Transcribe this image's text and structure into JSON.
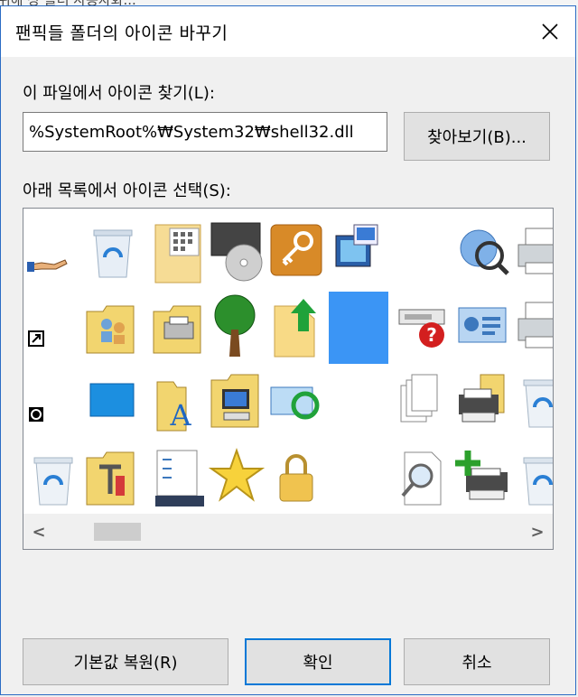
{
  "background": {
    "partial_text": "위해 상 폴더 사용자화..."
  },
  "dialog": {
    "title": "팬픽들 폴더의 아이콘 바꾸기",
    "close_glyph": "✕",
    "find_label": "이 파일에서 아이콘 찾기(L):",
    "path_value": "%SystemRoot%₩System32₩shell32.dll",
    "browse_label": "찾아보기(B)...",
    "select_label": "아래 목록에서 아이콘 선택(S):",
    "restore_label": "기본값 복원(R)",
    "ok_label": "확인",
    "cancel_label": "취소"
  },
  "icons": [
    [
      "hand-share-icon",
      "recycle-bin-full-icon",
      "calculator-grid-icon",
      "cd-drive-icon",
      "key-icon",
      "network-screen-icon",
      "empty-icon",
      "search-globe-icon",
      "printer-icon"
    ],
    [
      "shortcut-arrow-icon",
      "folder-people-icon",
      "folder-printer-icon",
      "tree-icon",
      "folder-upload-icon",
      "selected-blank-icon",
      "network-error-icon",
      "control-panel-icon",
      "printer-icon"
    ],
    [
      "clock-overlay-icon",
      "desktop-icon",
      "fonts-folder-icon",
      "folder-computer-icon",
      "sync-monitor-icon",
      "empty-icon",
      "documents-stack-icon",
      "printer-folder-icon",
      "recycle-bin-icon"
    ],
    [
      "recycle-bin-icon",
      "folder-tools-icon",
      "checklist-icon",
      "star-icon",
      "lock-icon",
      "empty-icon",
      "search-document-icon",
      "add-printer-icon",
      "recycle-bin-icon"
    ]
  ],
  "selected_icon": {
    "row": 1,
    "col": 5
  },
  "scrollbar": {
    "left_glyph": "<",
    "right_glyph": ">",
    "position": 0.05
  }
}
